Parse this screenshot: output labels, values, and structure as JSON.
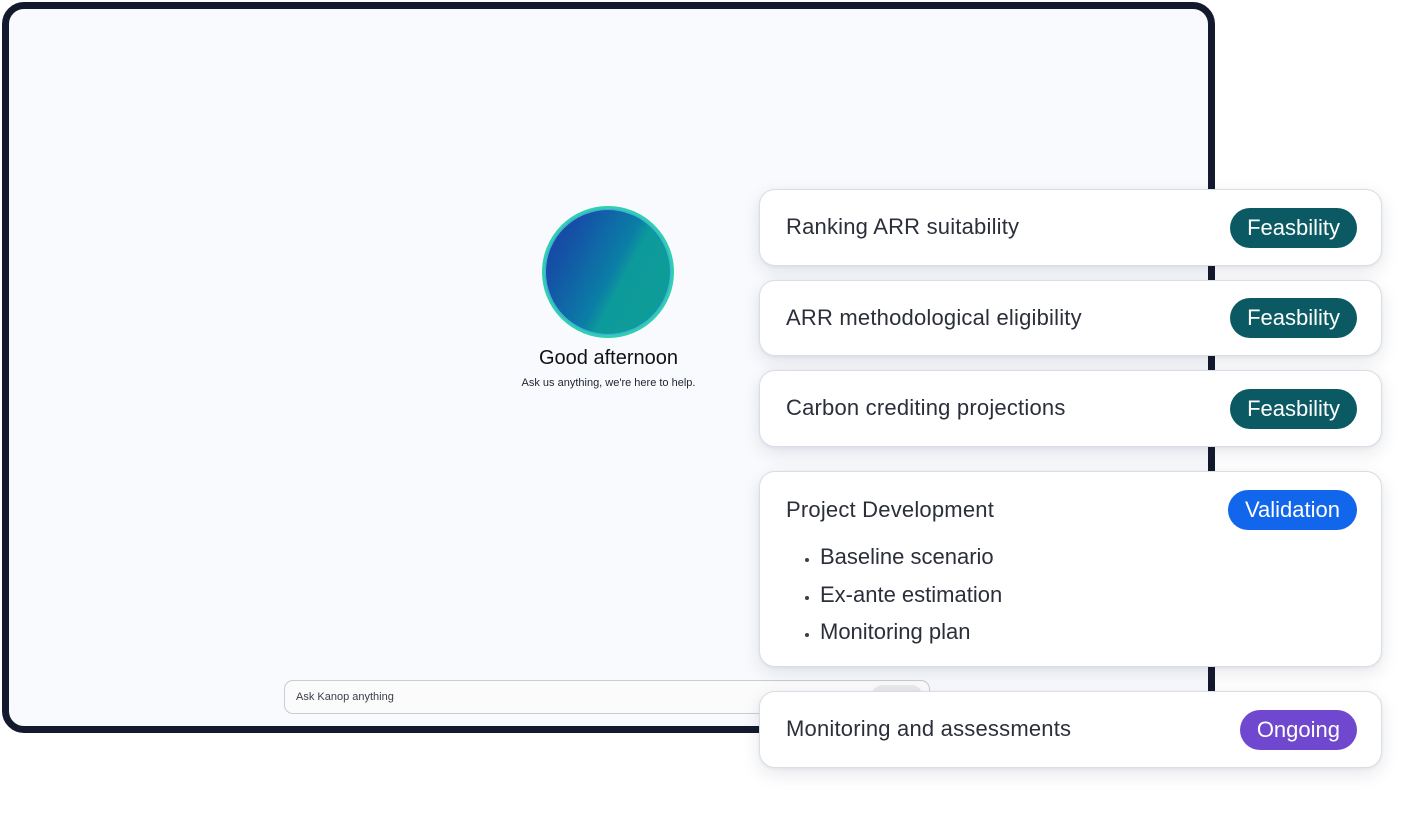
{
  "assistant": {
    "greeting": "Good afternoon",
    "subtitle": "Ask us anything, we're here to help.",
    "input_placeholder": "Ask Kanop anything"
  },
  "cards": [
    {
      "title": "Ranking ARR suitability",
      "status": "Feasbility",
      "status_color": "#0b5a63"
    },
    {
      "title": "ARR methodological eligibility",
      "status": "Feasbility",
      "status_color": "#0b5a63"
    },
    {
      "title": "Carbon crediting projections",
      "status": "Feasbility",
      "status_color": "#0b5a63"
    },
    {
      "title": "Project Development",
      "status": "Validation",
      "status_color": "#1166ec",
      "items": [
        "Baseline scenario",
        "Ex-ante estimation",
        "Monitoring plan"
      ]
    },
    {
      "title": "Monitoring and assessments",
      "status": "Ongoing",
      "status_color": "#6f48cf"
    }
  ],
  "colors": {
    "frame": "#141a2e",
    "screen_background": "#f8fafd",
    "orb_ring": "#2fd0b0"
  },
  "icons": {
    "assistant_avatar": "gradient-orb-icon"
  }
}
